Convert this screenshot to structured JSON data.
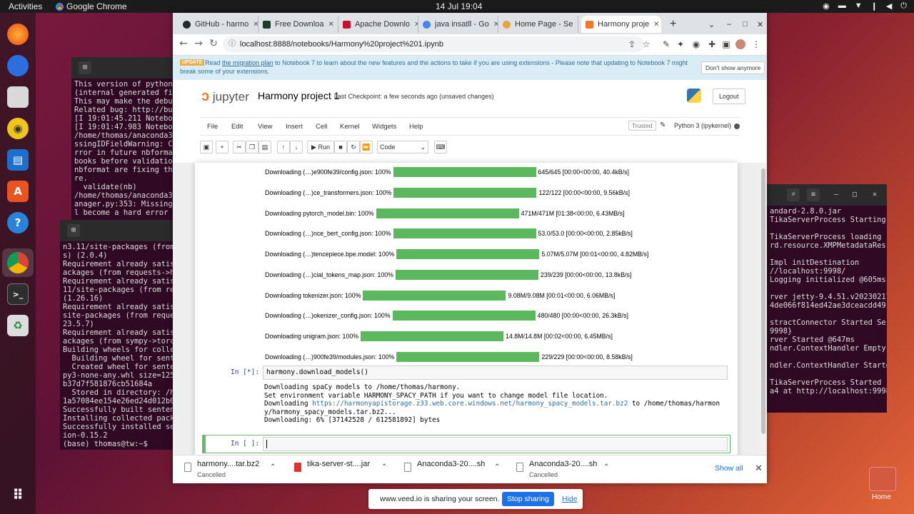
{
  "topbar": {
    "activities": "Activities",
    "app_name": "Google Chrome",
    "clock": "14 Jul  19:04"
  },
  "dock": {
    "icons": [
      "firefox-icon",
      "thunderbird-icon",
      "files-icon",
      "rhythmbox-icon",
      "writer-icon",
      "app-center-icon",
      "help-icon",
      "chrome-icon",
      "terminal-icon",
      "trash-icon"
    ],
    "apps_grid": "show-apps-icon"
  },
  "terminal_top": {
    "lines": [
      "This version of python",
      "(internal generated fil",
      "This may make the debug",
      "Related bug: http://bug",
      "[I 19:01:45.211 Noteboo",
      "[I 19:01:47.983 Noteboo",
      "/home/thomas/anaconda3/",
      "ssingIDFieldWarning: Co",
      "rror in future nbformat",
      "books before validation",
      "nbformat are fixing thi",
      "re.",
      "  validate(nb)",
      "/home/thomas/anaconda3/",
      "anager.py:353: MissingI",
      "l become a hard error i"
    ]
  },
  "terminal_left": {
    "lines": [
      "n3.11/site-packages (from",
      "s) (2.0.4)",
      "Requirement already satisf",
      "ackages (from requests->hu",
      "Requirement already satisf",
      "11/site-packages (from req",
      "(1.26.16)",
      "Requirement already satisf",
      "site-packages (from reques",
      "23.5.7)",
      "Requirement already satisf",
      "ackages (from sympy->torch",
      "Building wheels for collec",
      "  Building wheel for sente",
      "  Created wheel for senten",
      "py3-none-any.whl size=1259",
      "b37d7f581876cb51684a",
      "  Stored in directory: /ho",
      "1a57084ee154e26ed24d012b0c",
      "Successfully built sentenc",
      "Installing collected packa",
      "Successfully installed sen",
      "ion-0.15.2",
      "(base) thomas@tw:~$ "
    ]
  },
  "terminal_right": {
    "lines": [
      "andard-2.8.0.jar",
      "TikaServerProcess Starting",
      "",
      "TikaServerProcess loading",
      "rd.resource.XMPMetadataRes",
      "",
      "Impl initDestination",
      "//localhost:9998/",
      "Logging initialized @605ms",
      "",
      "rver jetty-9.4.51.v20230217",
      "4de066f814ed42ae3dceacdd49",
      "",
      "stractConnector Started Ser",
      "9998}",
      "rver Started @647ms",
      "ndler.ContextHandler Empty",
      "",
      "ndler.ContextHandler Starte",
      "",
      "TikaServerProcess Started",
      "a4 at http://localhost:9998"
    ]
  },
  "browser": {
    "tabs": [
      {
        "label": "GitHub - harmo",
        "color": "#24292e"
      },
      {
        "label": "Free Downloa",
        "color": "#1e3a2b"
      },
      {
        "label": "Apache Downlo",
        "color": "#c8102e"
      },
      {
        "label": "java insatll - Go",
        "color": "#4285f4"
      },
      {
        "label": "Home Page - Se",
        "color": "#e8a33d"
      },
      {
        "label": "Harmony proje",
        "color": "#f37726"
      }
    ],
    "new_tab": "+",
    "url": "localhost:8888/notebooks/Harmony%20project%201.ipynb"
  },
  "banner": {
    "badge": "UPDATE",
    "text_before": "Read ",
    "link": "the migration plan",
    "text_after": " to Notebook 7 to learn about the new features and the actions to take if you are using extensions - Please note that updating to Notebook 7 might break some of your extensions.",
    "dismiss": "Don't show anymore"
  },
  "jupyter": {
    "logo": "jupyter",
    "title": "Harmony project 1",
    "checkpoint": "Last Checkpoint: a few seconds ago  (unsaved changes)",
    "logout": "Logout",
    "menu": [
      "File",
      "Edit",
      "View",
      "Insert",
      "Cell",
      "Kernel",
      "Widgets",
      "Help"
    ],
    "trusted": "Trusted",
    "kernel": "Python 3 (ipykernel)",
    "run": "Run",
    "cell_type": "Code"
  },
  "progress": [
    {
      "label": "Downloading (…)e900fe39/config.json: 100%",
      "stats": "645/645 [00:00<00:00, 40.4kB/s]"
    },
    {
      "label": "Downloading (…)ce_transformers.json: 100%",
      "stats": "122/122 [00:00<00:00, 9.56kB/s]"
    },
    {
      "label": "Downloading pytorch_model.bin: 100%",
      "stats": "471M/471M [01:38<00:00, 6.43MB/s]"
    },
    {
      "label": "Downloading (…)nce_bert_config.json: 100%",
      "stats": "53.0/53.0 [00:00<00:00, 2.85kB/s]"
    },
    {
      "label": "Downloading (…)tencepiece.bpe.model: 100%",
      "stats": "5.07M/5.07M [00:01<00:00, 4.82MB/s]"
    },
    {
      "label": "Downloading (…)cial_tokens_map.json: 100%",
      "stats": "239/239 [00:00<00:00, 13.8kB/s]"
    },
    {
      "label": "Downloading tokenizer.json: 100%",
      "stats": "9.08M/9.08M [00:01<00:00, 6.06MB/s]"
    },
    {
      "label": "Downloading (…)okenizer_config.json: 100%",
      "stats": "480/480 [00:00<00:00, 26.3kB/s]"
    },
    {
      "label": "Downloading unigram.json: 100%",
      "stats": "14.8M/14.8M [00:02<00:00, 6.45MB/s]"
    },
    {
      "label": "Downloading (…)900fe39/modules.json: 100%",
      "stats": "229/229 [00:00<00:00, 8.58kB/s]"
    }
  ],
  "cell_running": {
    "prompt": "In [*]:",
    "code": "harmony.download_models()",
    "output_line1": "Downloading spaCy models to /home/thomas/harmony.",
    "output_line2": "Set environment variable HARMONY_SPACY_PATH if you want to change model file location.",
    "output_line3_prefix": "Downloading ",
    "output_link": "https://harmonyapistorage.z33.web.core.windows.net/harmony_spacy_models.tar.bz2",
    "output_line3_suffix": " to /home/thomas/harmon",
    "output_line4": "y/harmony_spacy_models.tar.bz2...",
    "output_line5": "Downloading: 6% [37142528 / 612581892] bytes"
  },
  "cell_empty": {
    "prompt": "In [ ]:"
  },
  "downloads": [
    {
      "name": "harmony....tar.bz2",
      "status": "Cancelled"
    },
    {
      "name": "tika-server-st....jar",
      "status": ""
    },
    {
      "name": "Anaconda3-20....sh",
      "status": ""
    },
    {
      "name": "Anaconda3-20....sh",
      "status": "Cancelled"
    }
  ],
  "show_all": "Show all",
  "share": {
    "text": "www.veed.io is sharing your screen.",
    "stop": "Stop sharing",
    "hide": "Hide"
  },
  "desktop": {
    "home_label": "Home"
  }
}
